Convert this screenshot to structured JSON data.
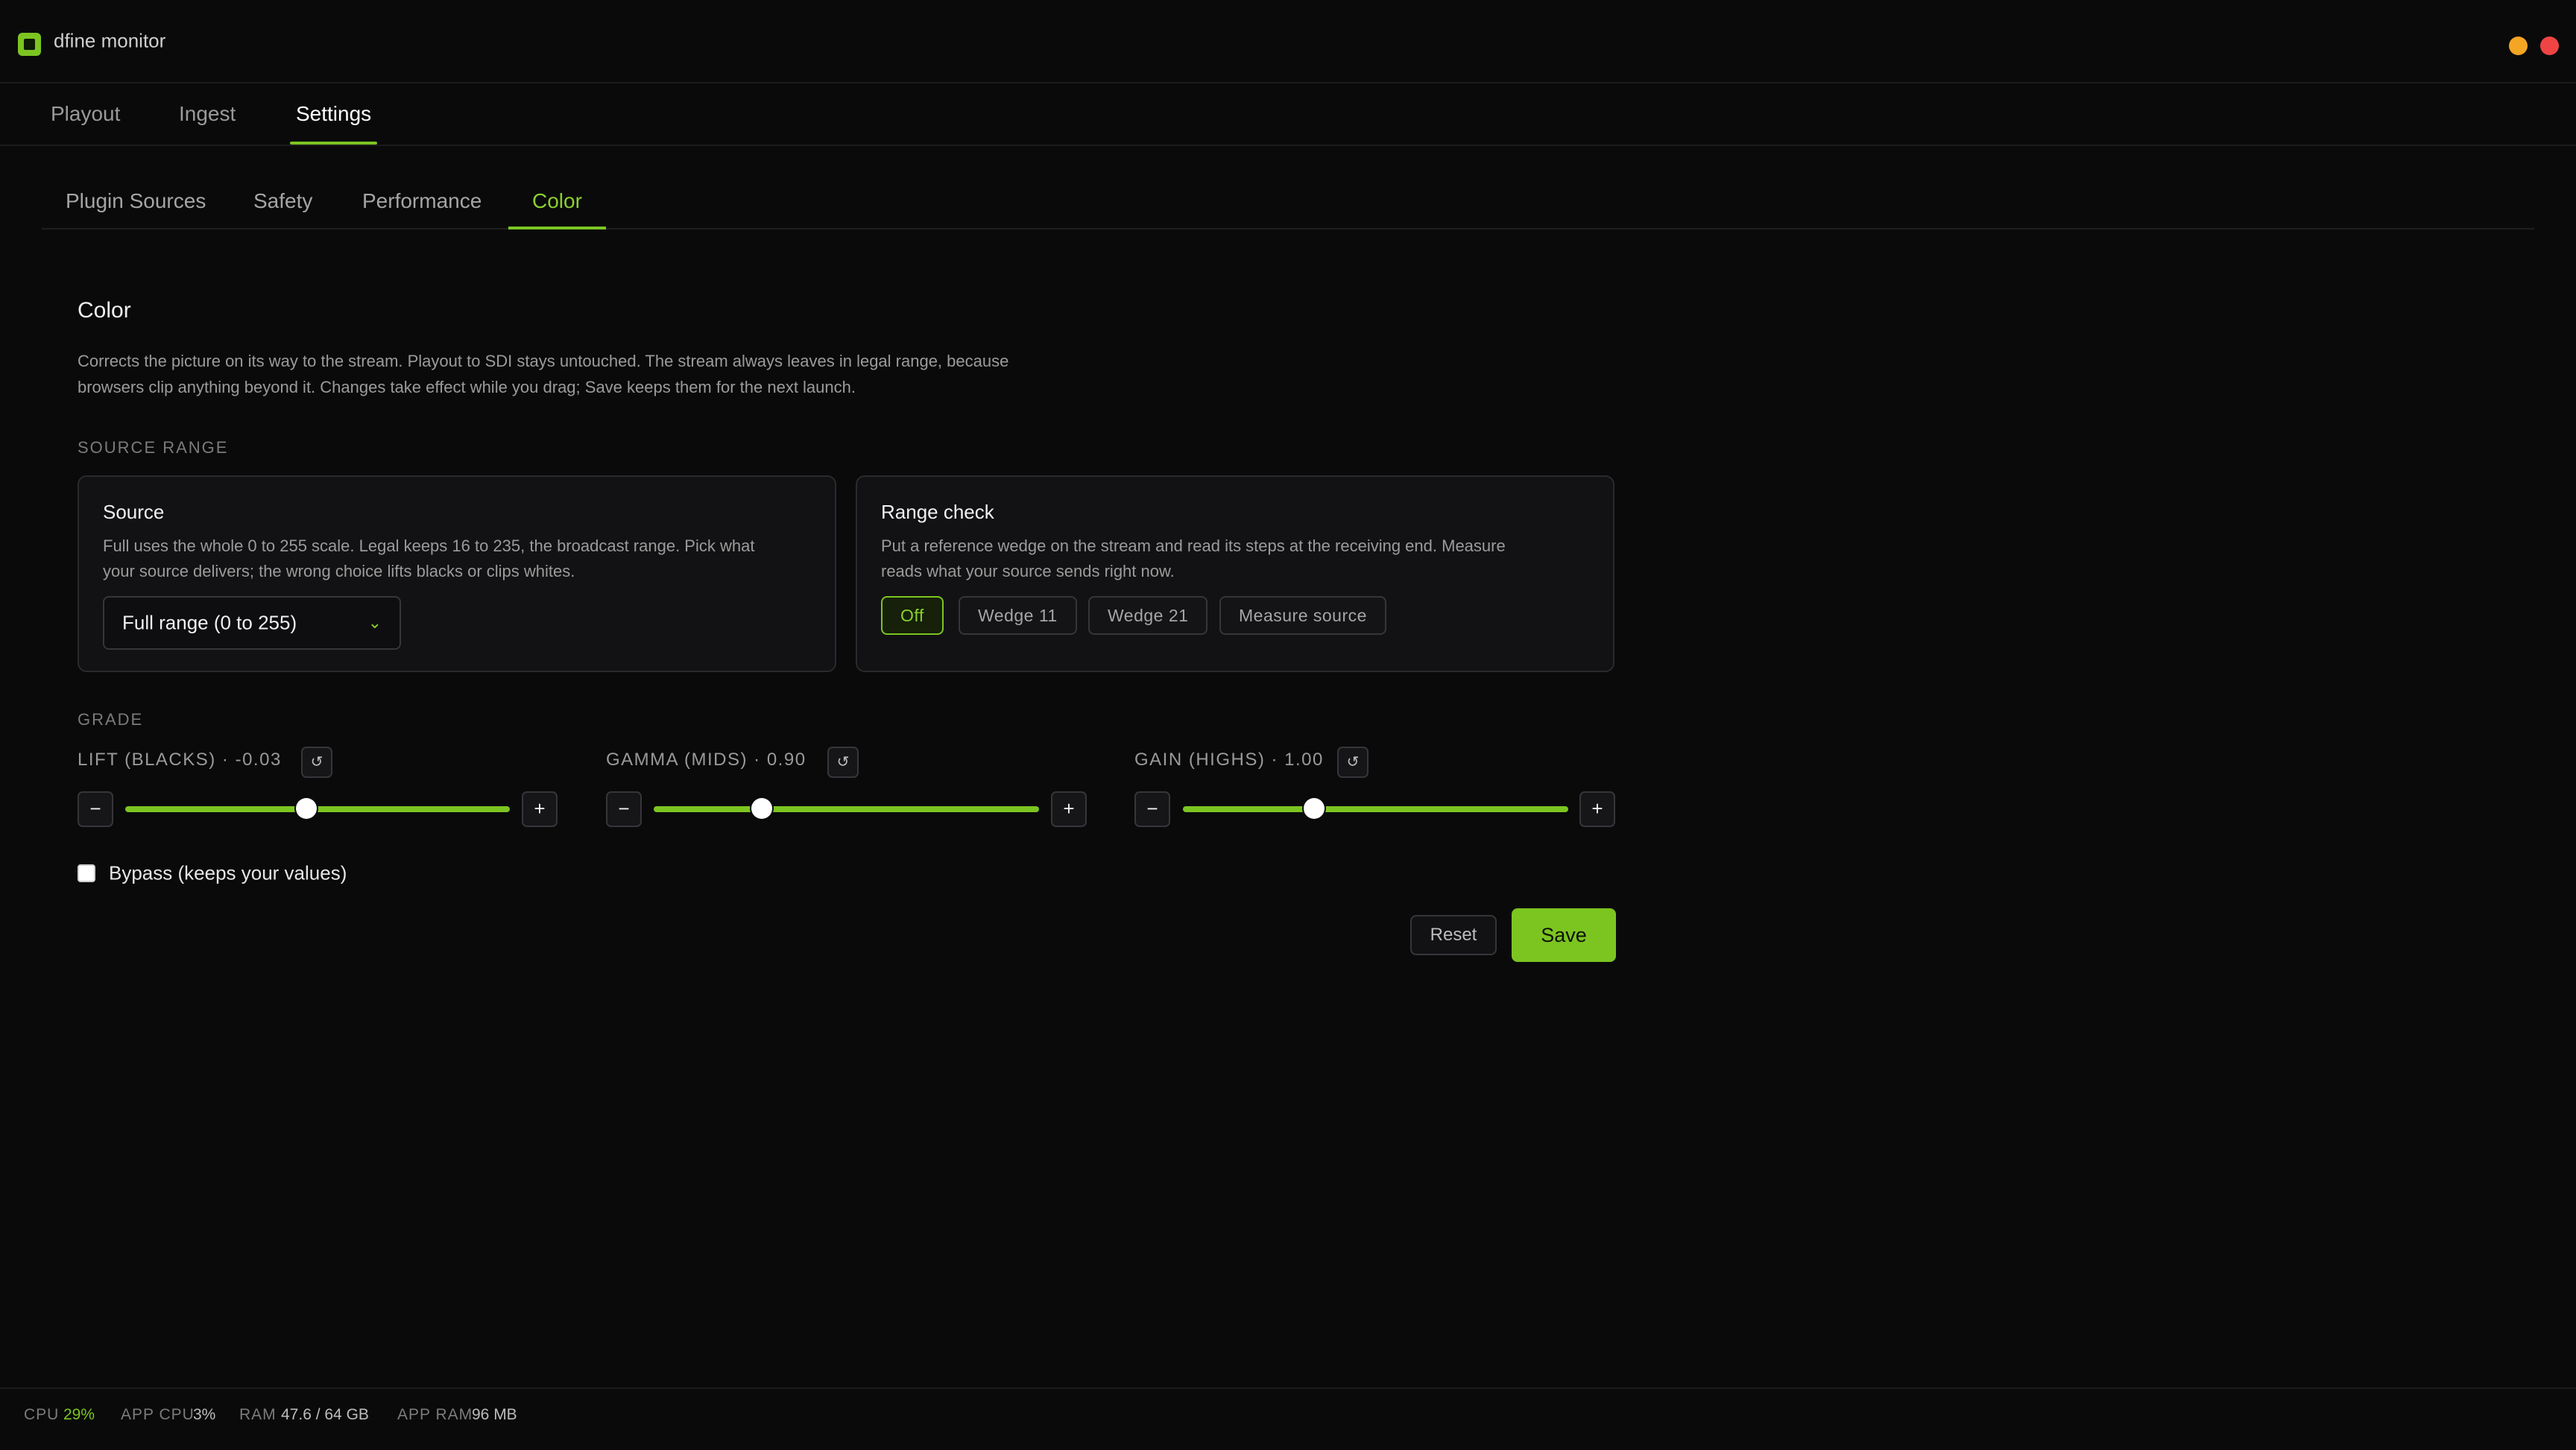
{
  "app": {
    "title": "dfine monitor"
  },
  "main_tabs": [
    {
      "label": "Playout"
    },
    {
      "label": "Ingest"
    },
    {
      "label": "Settings",
      "active": true
    }
  ],
  "sub_tabs": [
    {
      "label": "Plugin Sources"
    },
    {
      "label": "Safety"
    },
    {
      "label": "Performance"
    },
    {
      "label": "Color",
      "active": true
    }
  ],
  "color": {
    "title": "Color",
    "description_line1": "Corrects the picture on its way to the stream. Playout to SDI stays untouched. The stream always leaves in legal range, because",
    "description_line2": "browsers clip anything beyond it. Changes take effect while you drag; Save keeps them for the next launch."
  },
  "source_range": {
    "heading": "SOURCE RANGE",
    "source_card": {
      "title": "Source",
      "desc_line1": "Full uses the whole 0 to 255 scale. Legal keeps 16 to 235, the broadcast range. Pick what",
      "desc_line2": "your source delivers; the wrong choice lifts blacks or clips whites.",
      "selected": "Full range (0 to 255)"
    },
    "range_check_card": {
      "title": "Range check",
      "desc_line1": "Put a reference wedge on the stream and read its steps at the receiving end. Measure",
      "desc_line2": "reads what your source sends right now.",
      "options": [
        "Off",
        "Wedge 11",
        "Wedge 21",
        "Measure source"
      ],
      "active_option": "Off"
    }
  },
  "grade": {
    "heading": "GRADE",
    "sliders": [
      {
        "label": "LIFT (BLACKS) · -0.03",
        "value": -0.03,
        "position_fraction": 0.47
      },
      {
        "label": "GAMMA (MIDS) · 0.90",
        "value": 0.9,
        "position_fraction": 0.28
      },
      {
        "label": "GAIN (HIGHS) · 1.00",
        "value": 1.0,
        "position_fraction": 0.34
      }
    ],
    "reset_icon": "↺",
    "minus": "−",
    "plus": "+"
  },
  "bypass": {
    "label": "Bypass (keeps your values)",
    "checked": false
  },
  "actions": {
    "reset": "Reset",
    "save": "Save"
  },
  "status": {
    "cpu_label": "CPU",
    "cpu_value": "29%",
    "app_cpu_label": "APP CPU",
    "app_cpu_value": "3%",
    "ram_label": "RAM",
    "ram_value": "47.6 / 64 GB",
    "app_ram_label": "APP RAM",
    "app_ram_value": "96 MB"
  },
  "colors": {
    "accent": "#7cc521",
    "minimize": "#f5a524",
    "close": "#ef4444",
    "background": "#0a0a0b"
  }
}
